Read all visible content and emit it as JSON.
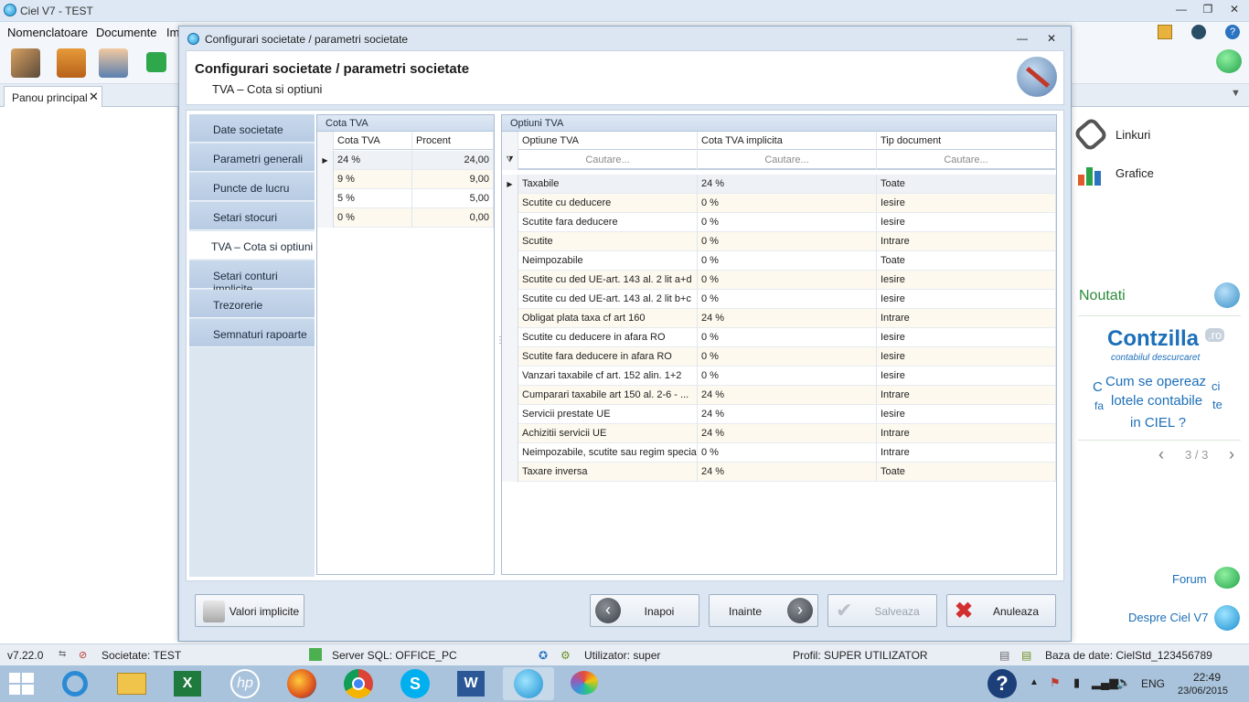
{
  "app": {
    "title": "Ciel V7 - TEST",
    "menu": [
      "Nomenclatoare",
      "Documente",
      "Im"
    ],
    "main_tab": "Panou principal"
  },
  "right_panel": {
    "links": "Linkuri",
    "charts": "Grafice",
    "news_title": "Noutati",
    "contzilla_brand": "Contzilla",
    "contzilla_tld": ".ro",
    "contzilla_tagline": "contabilul descurcaret",
    "promo_line1": "Cum se opereaz",
    "promo_ci": "ci",
    "promo_line2": "fa",
    "promo_line2b": "lotele contabile",
    "promo_te": "te",
    "promo_line3": "in CIEL ?",
    "pager": "3 / 3",
    "forum": "Forum",
    "about": "Despre Ciel V7"
  },
  "dialog": {
    "window_title": "Configurari societate / parametri societate",
    "header_title": "Configurari societate / parametri societate",
    "header_subtitle": "TVA – Cota si optiuni",
    "nav": [
      "Date societate",
      "Parametri generali",
      "Puncte de lucru",
      "Setari stocuri",
      "TVA – Cota si optiuni",
      "Setari conturi implicite",
      "Trezorerie",
      "Semnaturi rapoarte"
    ],
    "cota_panel": {
      "title": "Cota TVA",
      "headers": [
        "Cota TVA",
        "Procent"
      ],
      "rows": [
        [
          "24 %",
          "24,00"
        ],
        [
          "9 %",
          "9,00"
        ],
        [
          "5 %",
          "5,00"
        ],
        [
          "0 %",
          "0,00"
        ]
      ]
    },
    "optiuni_panel": {
      "title": "Optiuni TVA",
      "headers": [
        "Optiune TVA",
        "Cota TVA implicita",
        "Tip document"
      ],
      "filter_placeholder": "Cautare...",
      "rows": [
        [
          "Taxabile",
          "24 %",
          "Toate"
        ],
        [
          "Scutite cu deducere",
          "0 %",
          "Iesire"
        ],
        [
          "Scutite fara deducere",
          "0 %",
          "Iesire"
        ],
        [
          "Scutite",
          "0 %",
          "Intrare"
        ],
        [
          "Neimpozabile",
          "0 %",
          "Toate"
        ],
        [
          "Scutite cu ded UE-art. 143 al. 2 lit a+d",
          "0 %",
          "Iesire"
        ],
        [
          "Scutite cu ded UE-art. 143 al. 2 lit b+c",
          "0 %",
          "Iesire"
        ],
        [
          "Obligat plata taxa cf art 160",
          "24 %",
          "Intrare"
        ],
        [
          "Scutite cu deducere in afara RO",
          "0 %",
          "Iesire"
        ],
        [
          "Scutite fara deducere in afara RO",
          "0 %",
          "Iesire"
        ],
        [
          "Vanzari taxabile cf art. 152 alin. 1+2",
          "0 %",
          "Iesire"
        ],
        [
          "Cumparari taxabile art 150 al. 2-6 - ...",
          "24 %",
          "Intrare"
        ],
        [
          "Servicii prestate UE",
          "24 %",
          "Iesire"
        ],
        [
          "Achizitii servicii UE",
          "24 %",
          "Intrare"
        ],
        [
          "Neimpozabile, scutite sau regim special",
          "0 %",
          "Intrare"
        ],
        [
          "Taxare inversa",
          "24 %",
          "Toate"
        ]
      ]
    },
    "buttons": {
      "defaults": "Valori implicite",
      "back": "Inapoi",
      "next": "Inainte",
      "save": "Salveaza",
      "cancel": "Anuleaza"
    }
  },
  "status": {
    "version": "v7.22.0",
    "company": "Societate: TEST",
    "server": "Server SQL: OFFICE_PC",
    "user": "Utilizator: super",
    "profile": "Profil: SUPER UTILIZATOR",
    "database": "Baza de date: CielStd_123456789"
  },
  "taskbar": {
    "lang": "ENG",
    "time": "22:49",
    "date": "23/06/2015"
  },
  "colors": {
    "accent": "#1c6fb8",
    "nav_bg": "#c2d4ea",
    "dialog_bg": "#dbe6f2",
    "row_alt": "#fdf9ee"
  }
}
